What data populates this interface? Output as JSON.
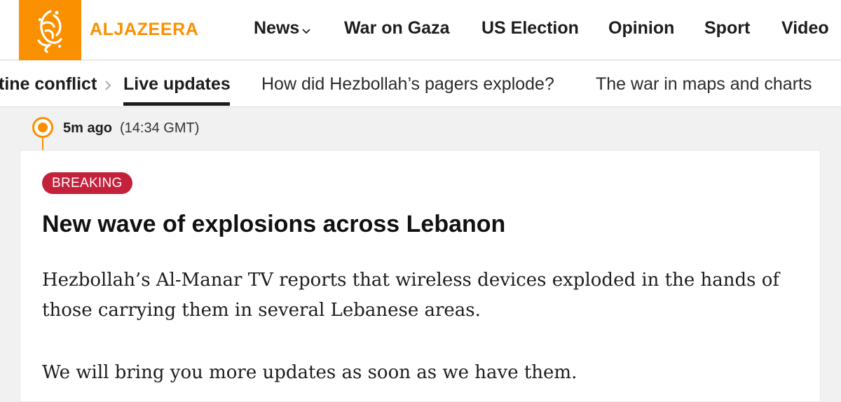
{
  "header": {
    "brand": "ALJAZEERA",
    "nav": [
      {
        "label": "News",
        "has_dropdown": true
      },
      {
        "label": "War on Gaza"
      },
      {
        "label": "US Election"
      },
      {
        "label": "Opinion"
      },
      {
        "label": "Sport"
      },
      {
        "label": "Video"
      }
    ]
  },
  "subnav": {
    "breadcrumb": "tine conflict",
    "active": "Live updates",
    "links": [
      "How did Hezbollah’s pagers explode?",
      "The war in maps and charts"
    ]
  },
  "post": {
    "time_ago": "5m ago",
    "time_gmt": "(14:34 GMT)",
    "badge": "BREAKING",
    "headline": "New wave of explosions across Lebanon",
    "paragraphs": [
      "Hezbollah’s Al-Manar TV reports that wireless devices exploded in the hands of those carrying them in several Lebanese areas.",
      "We will bring you more updates as soon as we have them."
    ]
  },
  "colors": {
    "brand_orange": "#fa9000",
    "breaking_red": "#c4213b"
  }
}
